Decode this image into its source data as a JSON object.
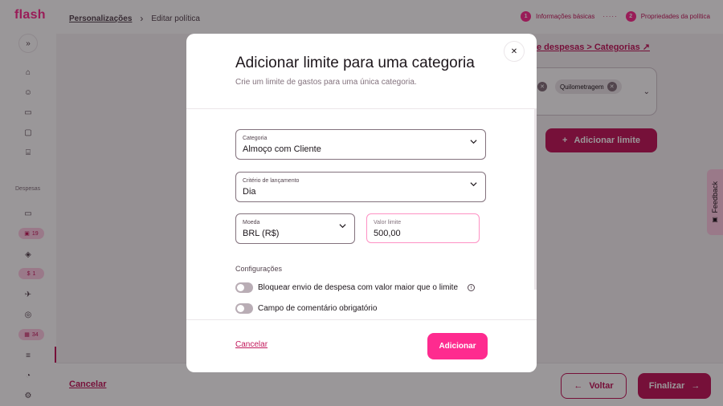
{
  "app": {
    "logo": "flash"
  },
  "breadcrumb": {
    "link": "Personalizações",
    "current": "Editar política"
  },
  "stepper": {
    "steps": [
      {
        "number": "1",
        "label": "Informações básicas"
      },
      {
        "number": "2",
        "label": "Propriedades da política"
      }
    ]
  },
  "sidebar": {
    "section_label": "Despesas",
    "badges": [
      "19",
      "1",
      "34"
    ]
  },
  "background": {
    "link": "e despesas > Categorias",
    "tag": "Quilometragem",
    "add_limit_button": "Adicionar limite"
  },
  "feedback": {
    "label": "Feedback"
  },
  "footer": {
    "cancel": "Cancelar",
    "back": "Voltar",
    "finish": "Finalizar"
  },
  "modal": {
    "title": "Adicionar limite para uma categoria",
    "subtitle": "Crie um limite de gastos para uma única categoria.",
    "fields": {
      "category": {
        "label": "Categoria",
        "value": "Almoço com Cliente"
      },
      "criterion": {
        "label": "Critério de lançamento",
        "value": "Dia"
      },
      "currency": {
        "label": "Moeda",
        "value": "BRL (R$)"
      },
      "limit_value": {
        "label": "Valor limite",
        "value": "500,00"
      }
    },
    "config_title": "Configurações",
    "toggles": [
      {
        "label": "Bloquear envio de despesa com valor maior que o limite",
        "on": false
      },
      {
        "label": "Campo de comentário obrigatório",
        "on": false
      }
    ],
    "cancel": "Cancelar",
    "submit": "Adicionar"
  },
  "colors": {
    "brand": "#fe2b8f",
    "brand_dark": "#c2185b",
    "overlay": "#0f080c"
  }
}
